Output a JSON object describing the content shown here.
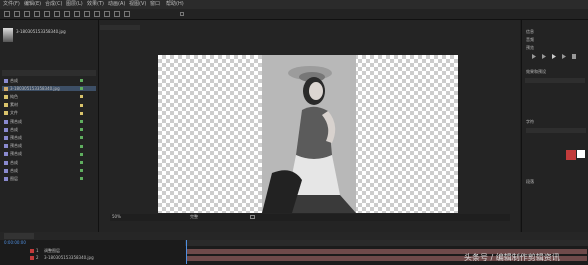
{
  "menu": [
    "文件(F)",
    "编辑(E)",
    "合成(C)",
    "图层(L)",
    "效果(T)",
    "动画(A)",
    "视图(V)",
    "窗口",
    "帮助(H)"
  ],
  "watermark": "头条号 / 编辑制作剪辑资讯",
  "project": {
    "footage_name": "3-180305153358340.jpg",
    "items": [
      {
        "label": "合成",
        "type": "comp"
      },
      {
        "label": "3-180305153358340.jpg",
        "type": "footage",
        "selected": true
      },
      {
        "label": "纯色",
        "type": "folder"
      },
      {
        "label": "素材",
        "type": "folder"
      },
      {
        "label": "文件",
        "type": "folder"
      },
      {
        "label": "预合成",
        "type": "comp"
      },
      {
        "label": "合成",
        "type": "comp"
      },
      {
        "label": "预合成",
        "type": "comp"
      },
      {
        "label": "预合成",
        "type": "comp"
      },
      {
        "label": "预合成",
        "type": "comp"
      },
      {
        "label": "合成",
        "type": "comp"
      },
      {
        "label": "合成",
        "type": "comp"
      },
      {
        "label": "图层",
        "type": "comp"
      }
    ]
  },
  "viewer": {
    "zoom": "50%",
    "quality": "完整"
  },
  "right_panel": {
    "labels": [
      "信息",
      "音频",
      "预览",
      "效果和预设",
      "字符",
      "段落"
    ]
  },
  "timeline": {
    "timecode": "0:00:00:00",
    "layers": [
      {
        "index": "1",
        "name": "调整图层"
      },
      {
        "index": "2",
        "name": "3-180305153358340.jpg"
      }
    ]
  },
  "colors": {
    "accent": "#4f8fe0",
    "selection": "#3d4f66",
    "label_red": "#c23b3b",
    "layer_bar": "#6e4a4a"
  }
}
